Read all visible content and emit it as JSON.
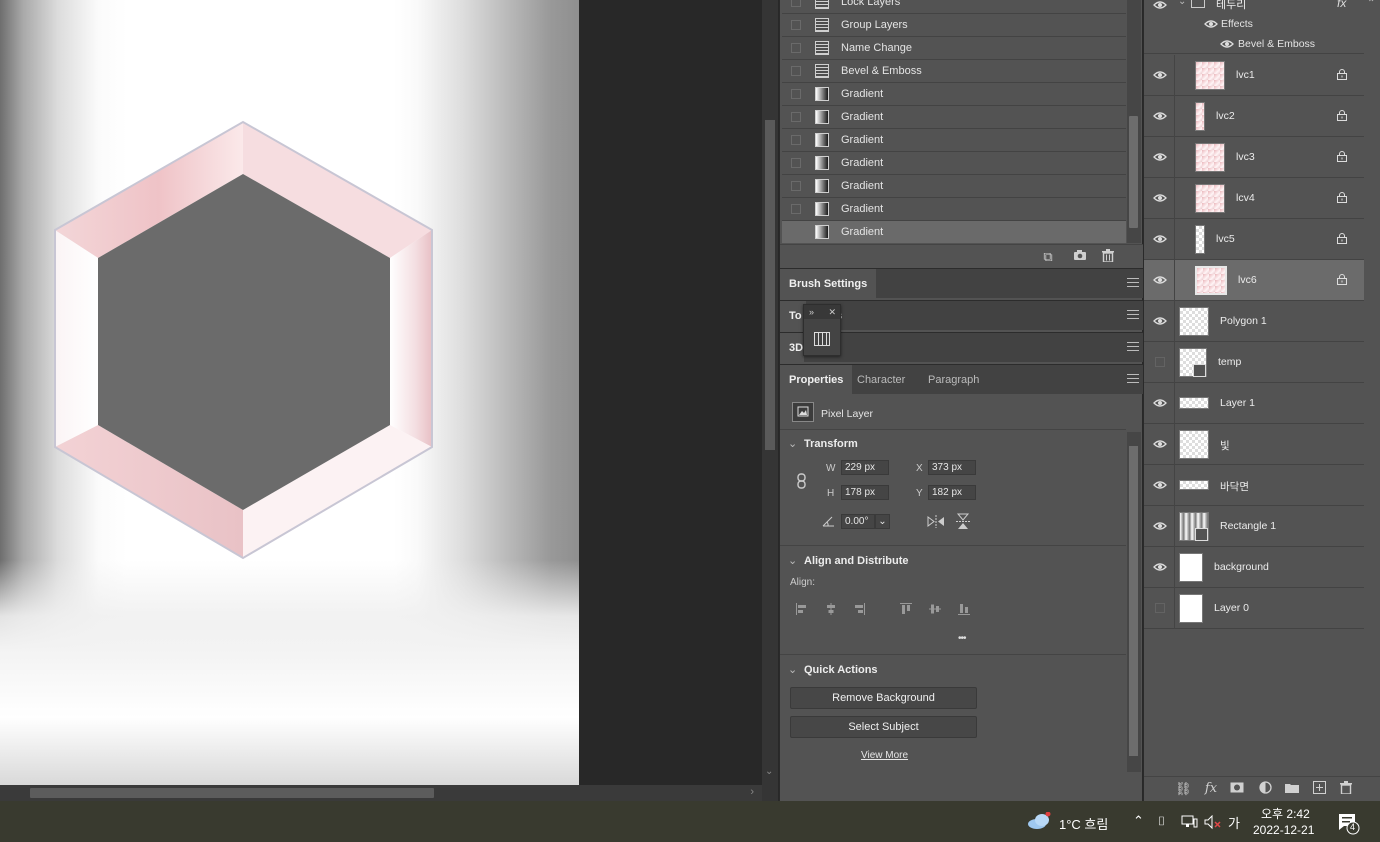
{
  "history": {
    "items": [
      {
        "label": "Lock Layers",
        "icon": "document-icon"
      },
      {
        "label": "Group Layers",
        "icon": "document-icon"
      },
      {
        "label": "Name Change",
        "icon": "document-icon"
      },
      {
        "label": "Bevel & Emboss",
        "icon": "document-icon"
      },
      {
        "label": "Gradient",
        "icon": "gradient-icon"
      },
      {
        "label": "Gradient",
        "icon": "gradient-icon"
      },
      {
        "label": "Gradient",
        "icon": "gradient-icon"
      },
      {
        "label": "Gradient",
        "icon": "gradient-icon"
      },
      {
        "label": "Gradient",
        "icon": "gradient-icon"
      },
      {
        "label": "Gradient",
        "icon": "gradient-icon"
      },
      {
        "label": "Gradient",
        "icon": "gradient-icon"
      }
    ],
    "selected_index": 10
  },
  "panels": {
    "brush_settings": "Brush Settings",
    "tool_presets_a": "To",
    "tool_presets_b": "s",
    "three_d": "3D",
    "float_collapse": "»",
    "float_close": "✕",
    "tabs": [
      "Properties",
      "Character",
      "Paragraph"
    ]
  },
  "properties": {
    "layer_type": "Pixel Layer",
    "transform": {
      "title": "Transform",
      "w_label": "W",
      "w": "229 px",
      "h_label": "H",
      "h": "178 px",
      "x_label": "X",
      "x": "373 px",
      "y_label": "Y",
      "y": "182 px",
      "angle": "0.00°"
    },
    "align": {
      "title": "Align and Distribute",
      "label": "Align:",
      "more": "•••"
    },
    "quick_actions": {
      "title": "Quick Actions",
      "remove_bg": "Remove Background",
      "select_subject": "Select Subject",
      "view_more": "View More"
    }
  },
  "layers": {
    "group": {
      "name": "테두리",
      "fx": "fx",
      "effects": "Effects",
      "bevel": "Bevel & Emboss"
    },
    "items": [
      {
        "name": "lvc1",
        "visible": true,
        "locked": true
      },
      {
        "name": "lvc2",
        "visible": true,
        "locked": true
      },
      {
        "name": "lvc3",
        "visible": true,
        "locked": true
      },
      {
        "name": "lcv4",
        "visible": true,
        "locked": true
      },
      {
        "name": "lvc5",
        "visible": true,
        "locked": true
      },
      {
        "name": "lvc6",
        "visible": true,
        "locked": true,
        "selected": true
      },
      {
        "name": "Polygon 1",
        "visible": true,
        "locked": false
      },
      {
        "name": "temp",
        "visible": false,
        "locked": false
      },
      {
        "name": "Layer 1",
        "visible": true,
        "locked": false
      },
      {
        "name": "빛",
        "visible": true,
        "locked": false
      },
      {
        "name": "바닥면",
        "visible": true,
        "locked": false
      },
      {
        "name": "Rectangle 1",
        "visible": true,
        "locked": false
      },
      {
        "name": "background",
        "visible": true,
        "locked": false
      },
      {
        "name": "Layer 0",
        "visible": false,
        "locked": false
      }
    ]
  },
  "taskbar": {
    "weather": "1°C  흐림",
    "ime": "가",
    "time": "오후 2:42",
    "date": "2022-12-21",
    "notifications": "4"
  },
  "colors": {
    "panel_bg": "#535353",
    "panel_dark": "#424242",
    "hex_frame_pink": "#f0c8cc",
    "hex_center": "#6b6b6b",
    "taskbar_bg": "#393a2f"
  }
}
